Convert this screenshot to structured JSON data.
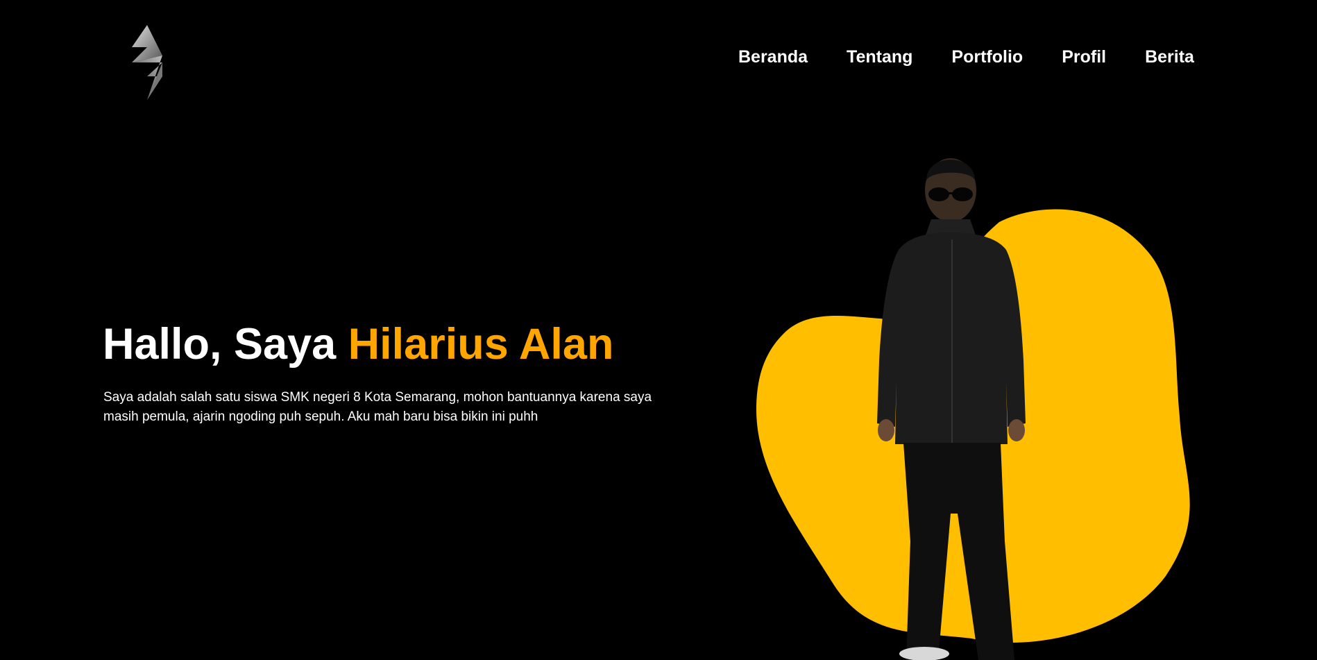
{
  "nav": {
    "items": [
      "Beranda",
      "Tentang",
      "Portfolio",
      "Profil",
      "Berita"
    ]
  },
  "hero": {
    "greeting": "Hallo, Saya ",
    "name": "Hilarius Alan",
    "description": "Saya adalah salah satu siswa SMK negeri 8 Kota Semarang, mohon bantuannya karena saya masih pemula, ajarin ngoding puh sepuh. Aku mah baru bisa bikin ini puhh"
  },
  "colors": {
    "background": "#000000",
    "accent": "#FFA500",
    "blob": "#FFBF00",
    "text": "#FFFFFF"
  },
  "icons": {
    "logo": "lightning-s-logo-icon",
    "portrait": "person-portrait-image"
  }
}
